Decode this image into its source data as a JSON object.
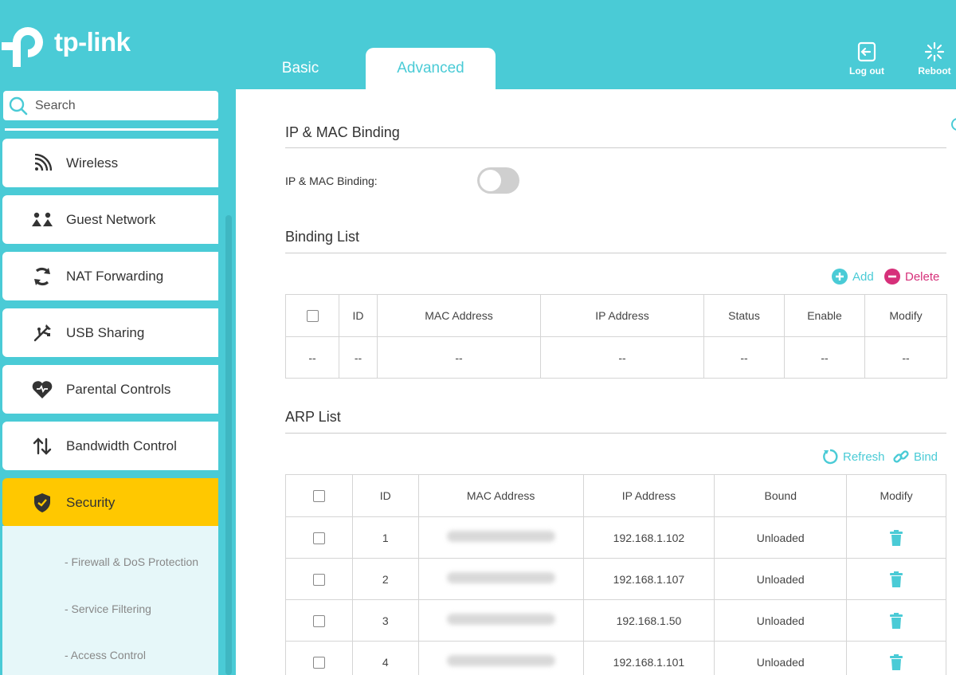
{
  "header": {
    "logo_text": "tp-link",
    "tabs": [
      {
        "label": "Basic",
        "active": false
      },
      {
        "label": "Advanced",
        "active": true
      }
    ],
    "logout_label": "Log out",
    "reboot_label": "Reboot"
  },
  "sidebar": {
    "search_placeholder": "Search",
    "items": [
      {
        "label": "Wireless",
        "icon": "wireless-icon"
      },
      {
        "label": "Guest Network",
        "icon": "guest-network-icon"
      },
      {
        "label": "NAT Forwarding",
        "icon": "nat-forwarding-icon"
      },
      {
        "label": "USB Sharing",
        "icon": "usb-icon"
      },
      {
        "label": "Parental Controls",
        "icon": "heart-icon"
      },
      {
        "label": "Bandwidth Control",
        "icon": "bandwidth-arrows-icon"
      },
      {
        "label": "Security",
        "icon": "shield-icon",
        "active": true
      }
    ],
    "sub_items": [
      "- Firewall & DoS Protection",
      "- Service Filtering",
      "- Access Control"
    ]
  },
  "main": {
    "section_ipmac": {
      "title": "IP & MAC Binding",
      "toggle_label": "IP & MAC Binding:",
      "toggle_on": false
    },
    "binding_list": {
      "title": "Binding List",
      "add_label": "Add",
      "delete_label": "Delete",
      "columns": [
        "",
        "ID",
        "MAC Address",
        "IP Address",
        "Status",
        "Enable",
        "Modify"
      ],
      "rows": [
        [
          "--",
          "--",
          "--",
          "--",
          "--",
          "--",
          "--"
        ]
      ]
    },
    "arp_list": {
      "title": "ARP List",
      "refresh_label": "Refresh",
      "bind_label": "Bind",
      "columns": [
        "",
        "ID",
        "MAC Address",
        "IP Address",
        "Bound",
        "Modify"
      ],
      "rows": [
        {
          "id": "1",
          "ip": "192.168.1.102",
          "bound": "Unloaded"
        },
        {
          "id": "2",
          "ip": "192.168.1.107",
          "bound": "Unloaded"
        },
        {
          "id": "3",
          "ip": "192.168.1.50",
          "bound": "Unloaded"
        },
        {
          "id": "4",
          "ip": "192.168.1.101",
          "bound": "Unloaded"
        }
      ]
    }
  },
  "colors": {
    "accent": "#4acbd6",
    "active_nav": "#ffc800",
    "delete": "#d6307a"
  }
}
